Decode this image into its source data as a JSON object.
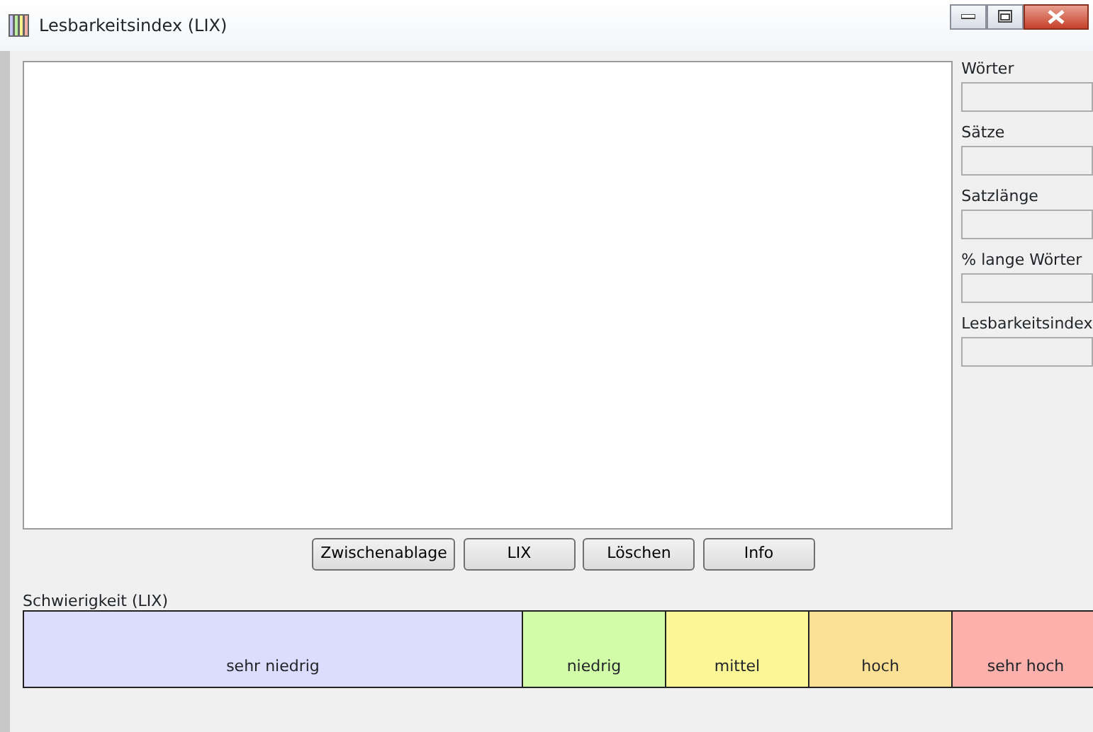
{
  "window": {
    "title": "Lesbarkeitsindex (LIX)"
  },
  "stats": [
    {
      "label": "Wörter"
    },
    {
      "label": "Sätze"
    },
    {
      "label": "Satzlänge"
    },
    {
      "label": "% lange Wörter"
    },
    {
      "label": "Lesbarkeitsindex"
    }
  ],
  "buttons": [
    "Zwischenablage",
    "LIX",
    "Löschen",
    "Info"
  ],
  "scale": {
    "title": "Schwierigkeit (LIX)",
    "segments": [
      {
        "label": "sehr niedrig",
        "color": "#dcdcfc"
      },
      {
        "label": "niedrig",
        "color": "#d2fca8"
      },
      {
        "label": "mittel",
        "color": "#fcf696"
      },
      {
        "label": "hoch",
        "color": "#fce096"
      },
      {
        "label": "sehr hoch",
        "color": "#fcb0ac"
      }
    ]
  }
}
